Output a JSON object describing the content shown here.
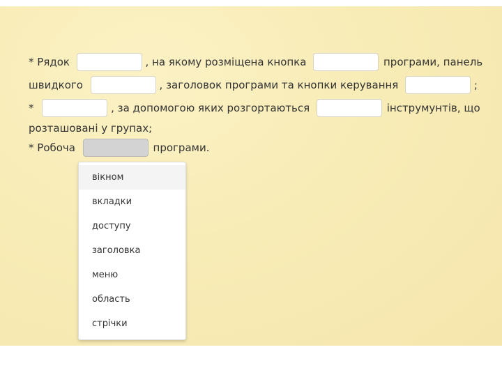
{
  "line1": {
    "t1": "* Рядок",
    "t2": ", на якому розміщена кнопка",
    "t3": "програми, панель"
  },
  "line2": {
    "t1": "швидкого",
    "t2": ", заголовок програми та кнопки керування",
    "t3": ";"
  },
  "line3": {
    "t1": "*",
    "t2": ", за допомогою яких розгортаються",
    "t3": "інструмунтів, що"
  },
  "line4": {
    "t1": "розташовані у групах;"
  },
  "line5": {
    "t1": "* Робоча",
    "t2": "програми."
  },
  "dropdown": {
    "options": [
      "вікном",
      "вкладки",
      "доступу",
      "заголовка",
      "меню",
      "область",
      "стрічки"
    ]
  }
}
